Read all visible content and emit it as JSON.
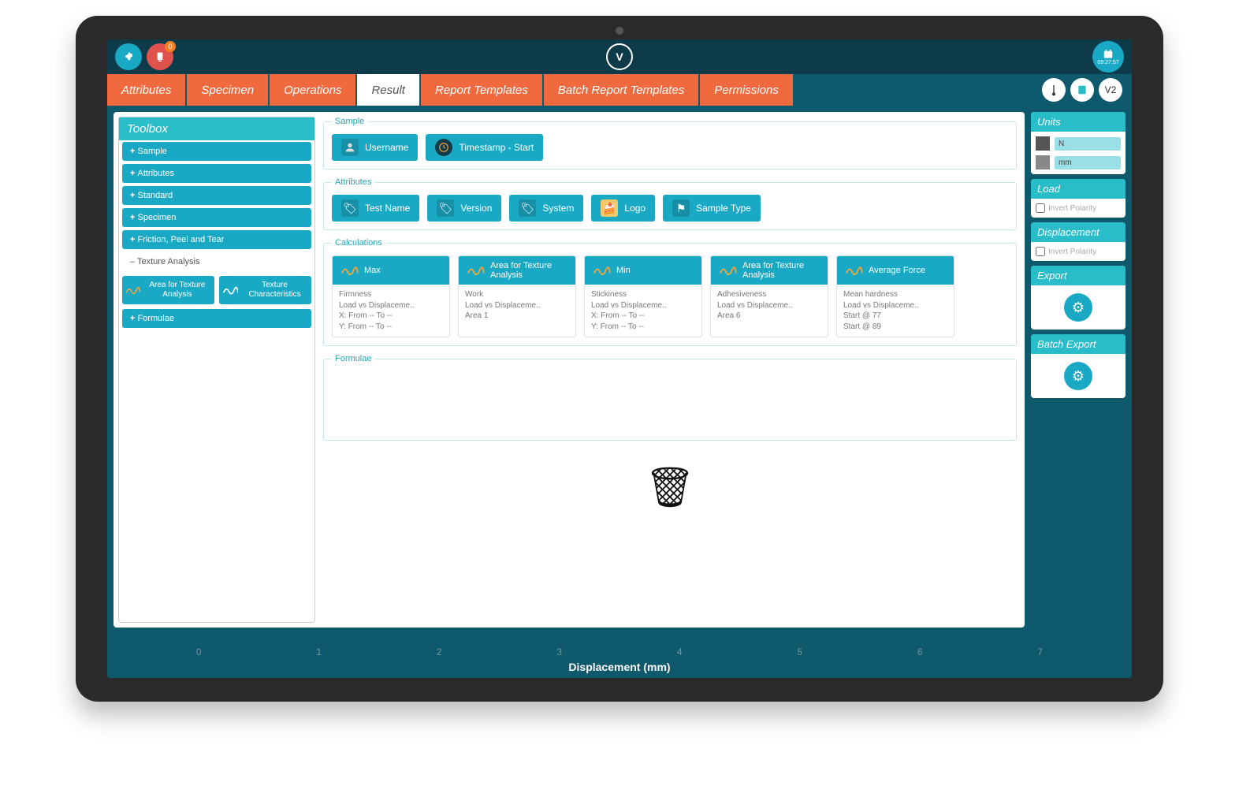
{
  "topbar": {
    "badge_count": "0",
    "clock_time": "09:27:57",
    "logo_letter": "V",
    "version_label": "V2"
  },
  "tabs": [
    {
      "label": "Attributes",
      "active": false
    },
    {
      "label": "Specimen",
      "active": false
    },
    {
      "label": "Operations",
      "active": false
    },
    {
      "label": "Result",
      "active": true
    },
    {
      "label": "Report Templates",
      "active": false
    },
    {
      "label": "Batch Report Templates",
      "active": false
    },
    {
      "label": "Permissions",
      "active": false
    }
  ],
  "toolbox": {
    "title": "Toolbox",
    "items": [
      "Sample",
      "Attributes",
      "Standard",
      "Specimen",
      "Friction, Peel and Tear"
    ],
    "expanded_label": "Texture Analysis",
    "cards": [
      "Area for Texture Analysis",
      "Texture Characteristics"
    ],
    "last_item": "Formulae"
  },
  "sections": {
    "sample": {
      "legend": "Sample",
      "chips": [
        {
          "icon": "user",
          "label": "Username"
        },
        {
          "icon": "clock",
          "label": "Timestamp - Start"
        }
      ]
    },
    "attributes": {
      "legend": "Attributes",
      "chips": [
        {
          "icon": "tag",
          "label": "Test Name"
        },
        {
          "icon": "tag",
          "label": "Version"
        },
        {
          "icon": "tag",
          "label": "System"
        },
        {
          "icon": "logo",
          "label": "Logo"
        },
        {
          "icon": "flag",
          "label": "Sample Type"
        }
      ]
    },
    "calculations": {
      "legend": "Calculations",
      "cards": [
        {
          "head": "Max",
          "lines": [
            "Firmness",
            "Load vs Displaceme..",
            "X: From -- To --",
            "Y: From -- To --"
          ]
        },
        {
          "head": "Area for Texture Analysis",
          "lines": [
            "Work",
            "Load vs Displaceme..",
            "Area 1"
          ]
        },
        {
          "head": "Min",
          "lines": [
            "Stickiness",
            "Load vs Displaceme..",
            "X: From -- To --",
            "Y: From -- To --"
          ]
        },
        {
          "head": "Area for Texture Analysis",
          "lines": [
            "Adhesiveness",
            "Load vs Displaceme..",
            "Area 6"
          ]
        },
        {
          "head": "Average Force",
          "lines": [
            "Mean hardness",
            "Load vs Displaceme..",
            "Start @ 77",
            "Start @ 89"
          ]
        }
      ]
    },
    "formulae": {
      "legend": "Formulae"
    }
  },
  "right": {
    "units": {
      "title": "Units",
      "force_value": "N",
      "length_value": "mm"
    },
    "load": {
      "title": "Load",
      "checkbox": "Invert Polarity"
    },
    "displacement": {
      "title": "Displacement",
      "checkbox": "Invert Polarity"
    },
    "export": {
      "title": "Export"
    },
    "batch_export": {
      "title": "Batch Export"
    }
  },
  "axis": {
    "ticks": [
      "0",
      "1",
      "2",
      "3",
      "4",
      "5",
      "6",
      "7"
    ],
    "label": "Displacement (mm)"
  }
}
